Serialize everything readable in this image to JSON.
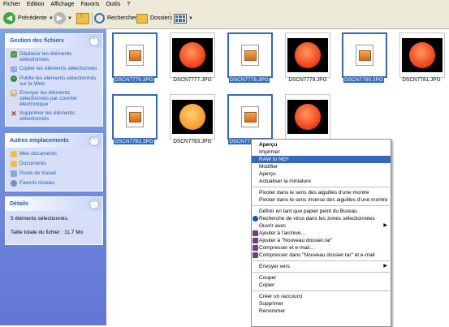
{
  "menubar": [
    "Fichier",
    "Edition",
    "Affichage",
    "Favoris",
    "Outils",
    "?"
  ],
  "toolbar": {
    "back": "Précédente",
    "search": "Rechercher",
    "folders": "Dossiers"
  },
  "tasks": {
    "title": "Gestion des fichiers",
    "items": [
      "Déplacer les éléments sélectionnés",
      "Copier les éléments sélectionnés",
      "Publie les éléments sélectionnés sur le Web",
      "Envoyer les éléments sélectionnés par courrier électronique",
      "Supprimer les éléments sélectionnés"
    ]
  },
  "places": {
    "title": "Autres emplacements",
    "items": [
      "Mes documents",
      "Documents",
      "Poste de travail",
      "Favoris réseau"
    ]
  },
  "details": {
    "title": "Détails",
    "count": "5 éléments sélectionnés.",
    "size": "Taille totale du fichier : 11,7 Mo"
  },
  "files": [
    {
      "name": "DSCN7776.3PG"
    },
    {
      "name": "DSCN7777.JPG"
    },
    {
      "name": "DSCN7778.3PG"
    },
    {
      "name": "DSCN7779.JPG"
    },
    {
      "name": "DSCN7780.3PG"
    },
    {
      "name": "DSCN7781.JPG"
    },
    {
      "name": "DSCN7782.3PG"
    },
    {
      "name": "DSCN7783.JPG"
    },
    {
      "name": "DSCN77"
    },
    {
      "name": ""
    }
  ],
  "context_menu": [
    "Aperçu",
    "Imprimer",
    "RAW to NEF",
    "Modifier",
    "Aperçu",
    "Actualiser la miniature",
    "Pivoter dans le sens des aiguilles d'une montre",
    "Pivoter dans le sens inverse des aiguilles d'une montre",
    "Définir en tant que papier peint du Bureau",
    "Recherche de virus dans les zones sélectionnées",
    "Ouvrir avec",
    "Ajouter à l'archive...",
    "Ajouter à \"Nouveau dossier.rar\"",
    "Compresser et e-mail...",
    "Compresser dans \"Nouveau dossier.rar\" et e-mail",
    "Envoyer vers",
    "Couper",
    "Copier",
    "Créer un raccourci",
    "Supprimer",
    "Renommer"
  ],
  "colors": {
    "selection": "#316ac5",
    "task_link": "#215dc6",
    "pane_top": "#7ba2e7",
    "pane_bottom": "#6375d6"
  }
}
